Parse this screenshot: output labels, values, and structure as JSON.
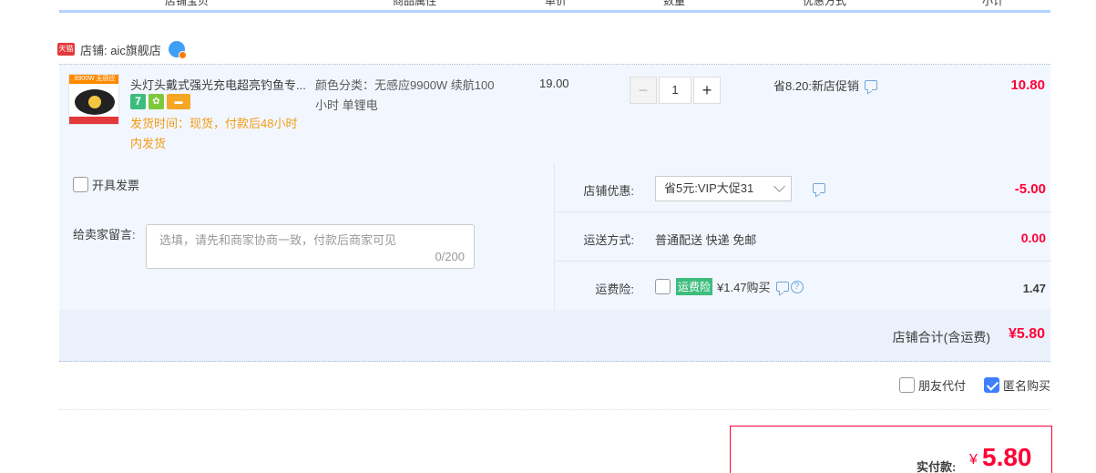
{
  "columns": [
    "店铺宝贝",
    "商品属性",
    "单价",
    "数量",
    "优惠方式",
    "小计"
  ],
  "shop": {
    "tag": "天猫",
    "label": "店铺: aic旗舰店"
  },
  "item": {
    "thumb_band": "9900W 无感应",
    "title": "头灯头戴式强光充电超亮钓鱼专...",
    "badge_seven": "7",
    "ship_time": "发货时间：现货，付款后48小时内发货",
    "attrs": "颜色分类：无感应9900W 续航100小时 单锂电",
    "price": "19.00",
    "qty_minus": "−",
    "qty": "1",
    "qty_plus": "+",
    "promo": "省8.20:新店促销",
    "subtotal": "10.80"
  },
  "left": {
    "invoice": "开具发票",
    "msg_label": "给卖家留言:",
    "msg_placeholder": "选填，请先和商家协商一致，付款后商家可见",
    "msg_count": "0/200"
  },
  "right": {
    "discount_label": "店铺优惠:",
    "discount_select": "省5元:VIP大促31",
    "discount_value": "-5.00",
    "shipping_label": "运送方式:",
    "shipping_text": "普通配送 快递 免邮",
    "shipping_value": "0.00",
    "insurance_label": "运费险:",
    "insurance_tag": "运费险",
    "insurance_text": "¥1.47购买",
    "insurance_help": "?",
    "insurance_value": "1.47"
  },
  "total": {
    "label": "店铺合计(含运费)",
    "value": "¥5.80"
  },
  "options": {
    "friend_pay": "朋友代付",
    "anonymous": "匿名购买"
  },
  "pay": {
    "label": "实付款:",
    "currency": "¥",
    "value": "5.80"
  },
  "colors": {
    "accent": "#ff0036",
    "brand_blue": "#3d7fff",
    "row_bg": "#f2f7ff"
  }
}
